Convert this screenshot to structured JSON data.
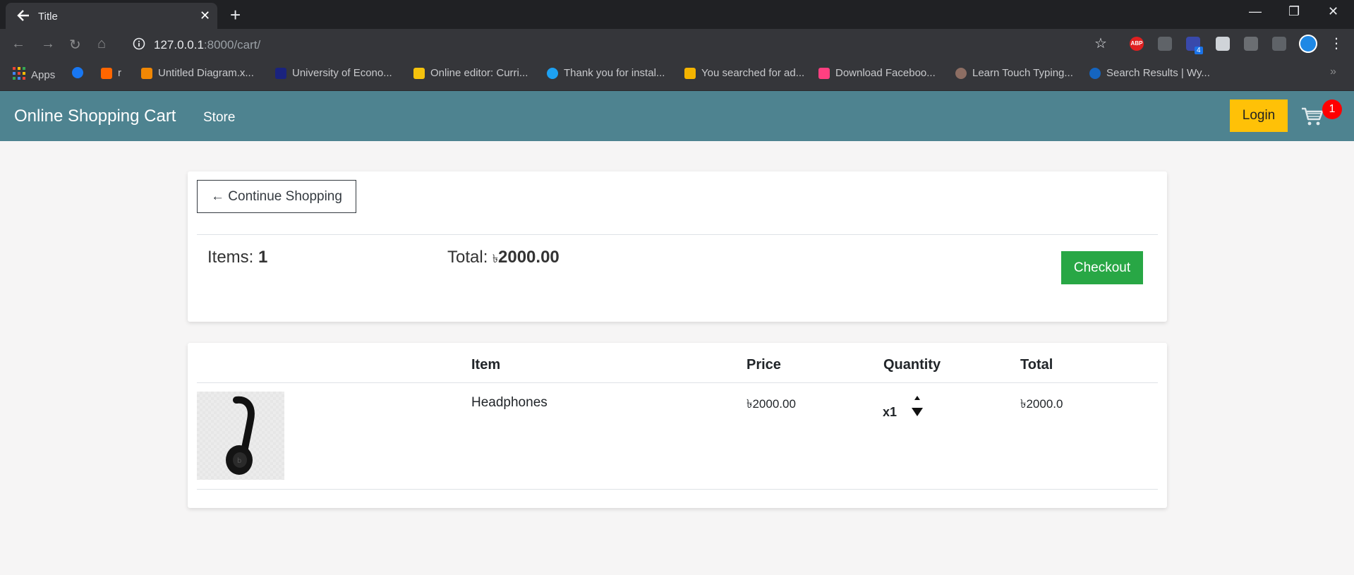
{
  "browser": {
    "tab_title": "Title",
    "url_host": "127.0.0.1",
    "url_rest": ":8000/cart/",
    "bookmarks": [
      {
        "label": "Apps",
        "color": "#ea4335"
      },
      {
        "label": "",
        "color": "#1877f2"
      },
      {
        "label": "r",
        "color": "#ff6600"
      },
      {
        "label": "Untitled Diagram.x...",
        "color": "#f08705"
      },
      {
        "label": "University of Econo...",
        "color": "#1a237e"
      },
      {
        "label": "Online editor: Curri...",
        "color": "#f4c20d"
      },
      {
        "label": "Thank you for instal...",
        "color": "#1da1f2"
      },
      {
        "label": "You searched for ad...",
        "color": "#f4b400"
      },
      {
        "label": "Download Faceboo...",
        "color": "#ff4081"
      },
      {
        "label": "Learn Touch Typing...",
        "color": "#8d6e63"
      },
      {
        "label": "Search Results | Wy...",
        "color": "#1565c0"
      }
    ],
    "extension_badge": "4"
  },
  "navbar": {
    "brand": "Online Shopping Cart",
    "store_link": "Store",
    "login_label": "Login",
    "cart_count": "1",
    "color": "#4e8390"
  },
  "summary": {
    "continue_label": "← Continue Shopping",
    "items_prefix": "Items: ",
    "items_count": "1",
    "total_prefix": "Total: ",
    "currency": "৳",
    "total_value": "2000.00",
    "checkout_label": "Checkout"
  },
  "table": {
    "headers": [
      "Item",
      "Price",
      "Quantity",
      "Total"
    ],
    "rows": [
      {
        "item": "Headphones",
        "price": "৳2000.00",
        "quantity": "x1",
        "total": "৳2000.0"
      }
    ]
  }
}
